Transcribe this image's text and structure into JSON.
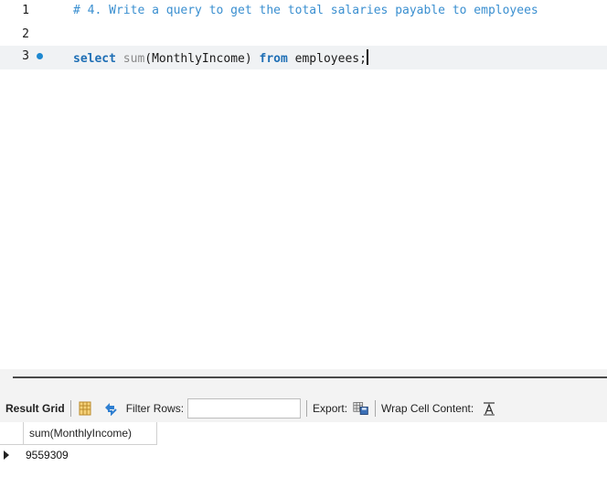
{
  "editor": {
    "lines": [
      {
        "number": "1",
        "text": "# 4. Write a query to get the total salaries payable to employees"
      },
      {
        "number": "2",
        "text": ""
      },
      {
        "number": "3",
        "tokens": {
          "kw1": "select",
          "fn": "sum",
          "args": "(MonthlyIncome) ",
          "kw2": "from",
          "rest": " employees;"
        }
      }
    ],
    "colors": {
      "comment": "#3a8fd0",
      "keyword": "#1f6fb5",
      "function": "#8a8a8a",
      "marker": "#1e88d0"
    }
  },
  "results": {
    "toolbar": {
      "title": "Result Grid",
      "filter_label": "Filter Rows:",
      "filter_value": "",
      "export_label": "Export:",
      "wrap_label": "Wrap Cell Content:"
    },
    "columns": [
      "sum(MonthlyIncome)"
    ],
    "rows": [
      [
        "9559309"
      ]
    ]
  }
}
